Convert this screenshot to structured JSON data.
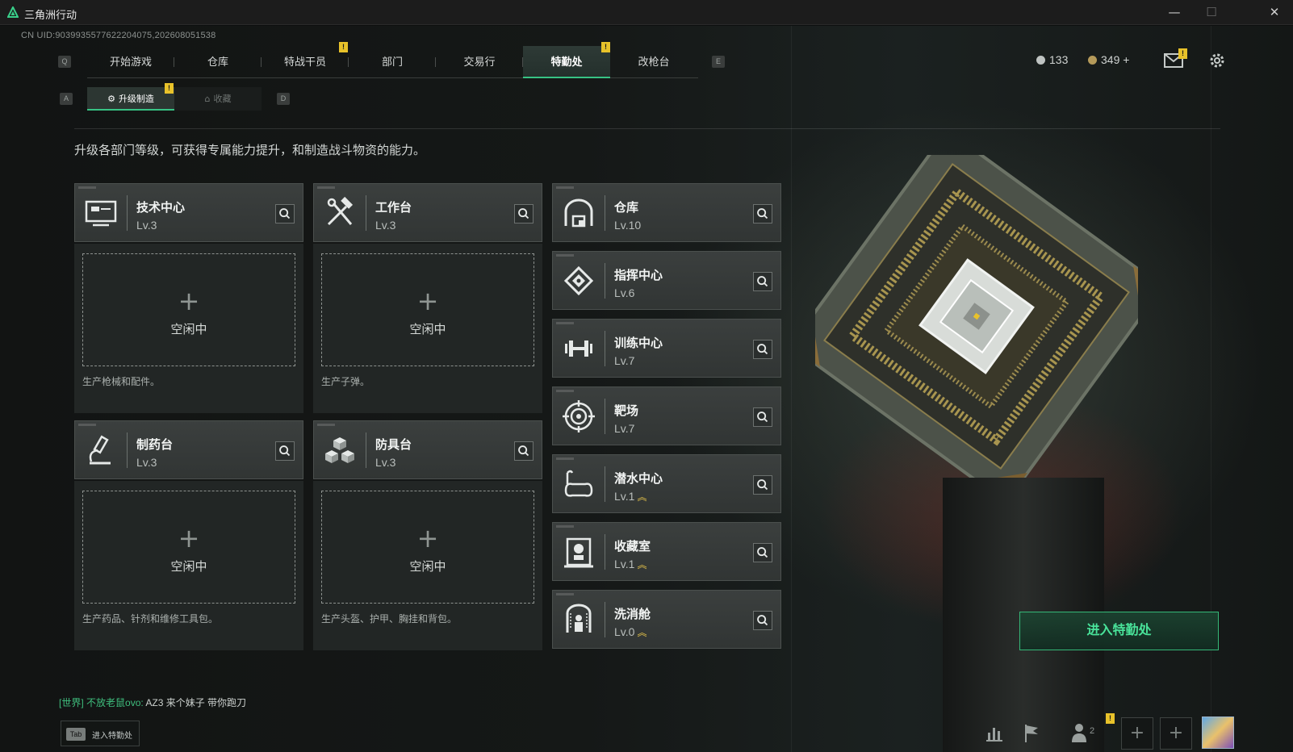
{
  "window": {
    "title": "三角洲行动",
    "min": "—",
    "max": "☐",
    "close": "✕"
  },
  "uid": "CN UID:9039935577622204075,202608051538",
  "nav": {
    "key_left": "Q",
    "key_right": "E",
    "tabs": [
      {
        "label": "开始游戏"
      },
      {
        "label": "仓库"
      },
      {
        "label": "特战干员"
      },
      {
        "label": "部门"
      },
      {
        "label": "交易行"
      },
      {
        "label": "特勤处",
        "active": true
      },
      {
        "label": "改枪台"
      }
    ],
    "badge": "!"
  },
  "subnav": {
    "key_left": "A",
    "key_right": "D",
    "tabs": [
      {
        "label": "升级制造",
        "active": true
      },
      {
        "label": "收藏"
      }
    ]
  },
  "currency": {
    "a": "133",
    "b": "349",
    "plus": "+"
  },
  "description": "升级各部门等级，可获得专属能力提升，和制造战斗物资的能力。",
  "production": [
    {
      "name": "技术中心",
      "level": "Lv.3",
      "slot_plus": "+",
      "slot_status": "空闲中",
      "note": "生产枪械和配件。"
    },
    {
      "name": "工作台",
      "level": "Lv.3",
      "slot_plus": "+",
      "slot_status": "空闲中",
      "note": "生产子弹。"
    },
    {
      "name": "制药台",
      "level": "Lv.3",
      "slot_plus": "+",
      "slot_status": "空闲中",
      "note": "生产药品、针剂和维修工具包。"
    },
    {
      "name": "防具台",
      "level": "Lv.3",
      "slot_plus": "+",
      "slot_status": "空闲中",
      "note": "生产头盔、护甲、胸挂和背包。"
    }
  ],
  "departments": [
    {
      "name": "仓库",
      "level": "Lv.10",
      "upgrade": ""
    },
    {
      "name": "指挥中心",
      "level": "Lv.6",
      "upgrade": ""
    },
    {
      "name": "训练中心",
      "level": "Lv.7",
      "upgrade": ""
    },
    {
      "name": "靶场",
      "level": "Lv.7",
      "upgrade": ""
    },
    {
      "name": "潜水中心",
      "level": "Lv.1",
      "upgrade": "︽"
    },
    {
      "name": "收藏室",
      "level": "Lv.1",
      "upgrade": "︽"
    },
    {
      "name": "洗消舱",
      "level": "Lv.0",
      "upgrade": "︽"
    }
  ],
  "enter_button": "进入特勤处",
  "chat": {
    "channel": "[世界]",
    "user": "不放老鼠ovo:",
    "message": "AZ3  来个妹子  带你跑刀"
  },
  "tab_hint": {
    "key": "Tab",
    "label": "进入特勤处"
  },
  "bottom": {
    "friends_count": "2",
    "add": "+"
  },
  "colors": {
    "accent": "#37c384",
    "badge": "#e8c22a",
    "upgrade": "#e6c34a"
  }
}
